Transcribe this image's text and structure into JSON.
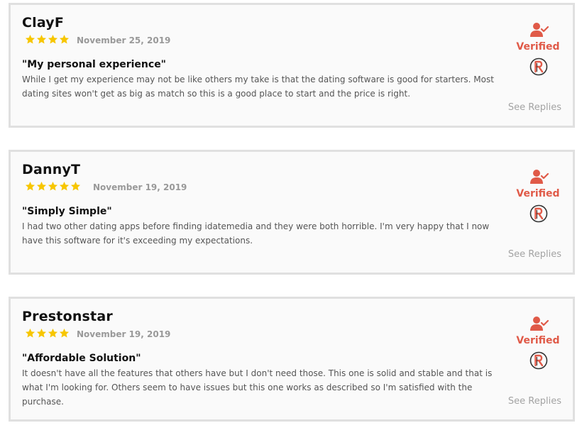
{
  "colors": {
    "star": "#f7c600",
    "verified": "#e05a48",
    "card_bg": "#fafafa",
    "card_border": "#e0e0e0",
    "muted": "#a3a3a3"
  },
  "reviews": [
    {
      "author": "ClayF",
      "rating": 4,
      "date": "November 25, 2019",
      "title": "\"My personal experience\"",
      "body": "While I get my experience may not be like others my take is that the dating software is good for starters. Most dating sites won't get as big as match so this is a good place to start and the price is right.",
      "verified_label": "Verified",
      "replies_label": "See Replies"
    },
    {
      "author": "DannyT",
      "rating": 5,
      "date": "November 19, 2019",
      "title": "\"Simply Simple\"",
      "body": "I had two other dating apps before finding idatemedia and they were both horrible. I'm very happy that I now have this software for it's exceeding my expectations.",
      "verified_label": "Verified",
      "replies_label": "See Replies"
    },
    {
      "author": "Prestonstar",
      "rating": 4,
      "date": "November 19, 2019",
      "title": "\"Affordable Solution\"",
      "body": "It doesn't have all the features that others have but I don't need those. This one is solid and stable and that is what I'm looking for. Others seem to have issues but this one works as described so I'm satisfied with the purchase.",
      "verified_label": "Verified",
      "replies_label": "See Replies"
    }
  ],
  "icons": {
    "verified": "user-check-icon",
    "badge": "reviewer-badge-icon",
    "rating": "star-icon"
  }
}
